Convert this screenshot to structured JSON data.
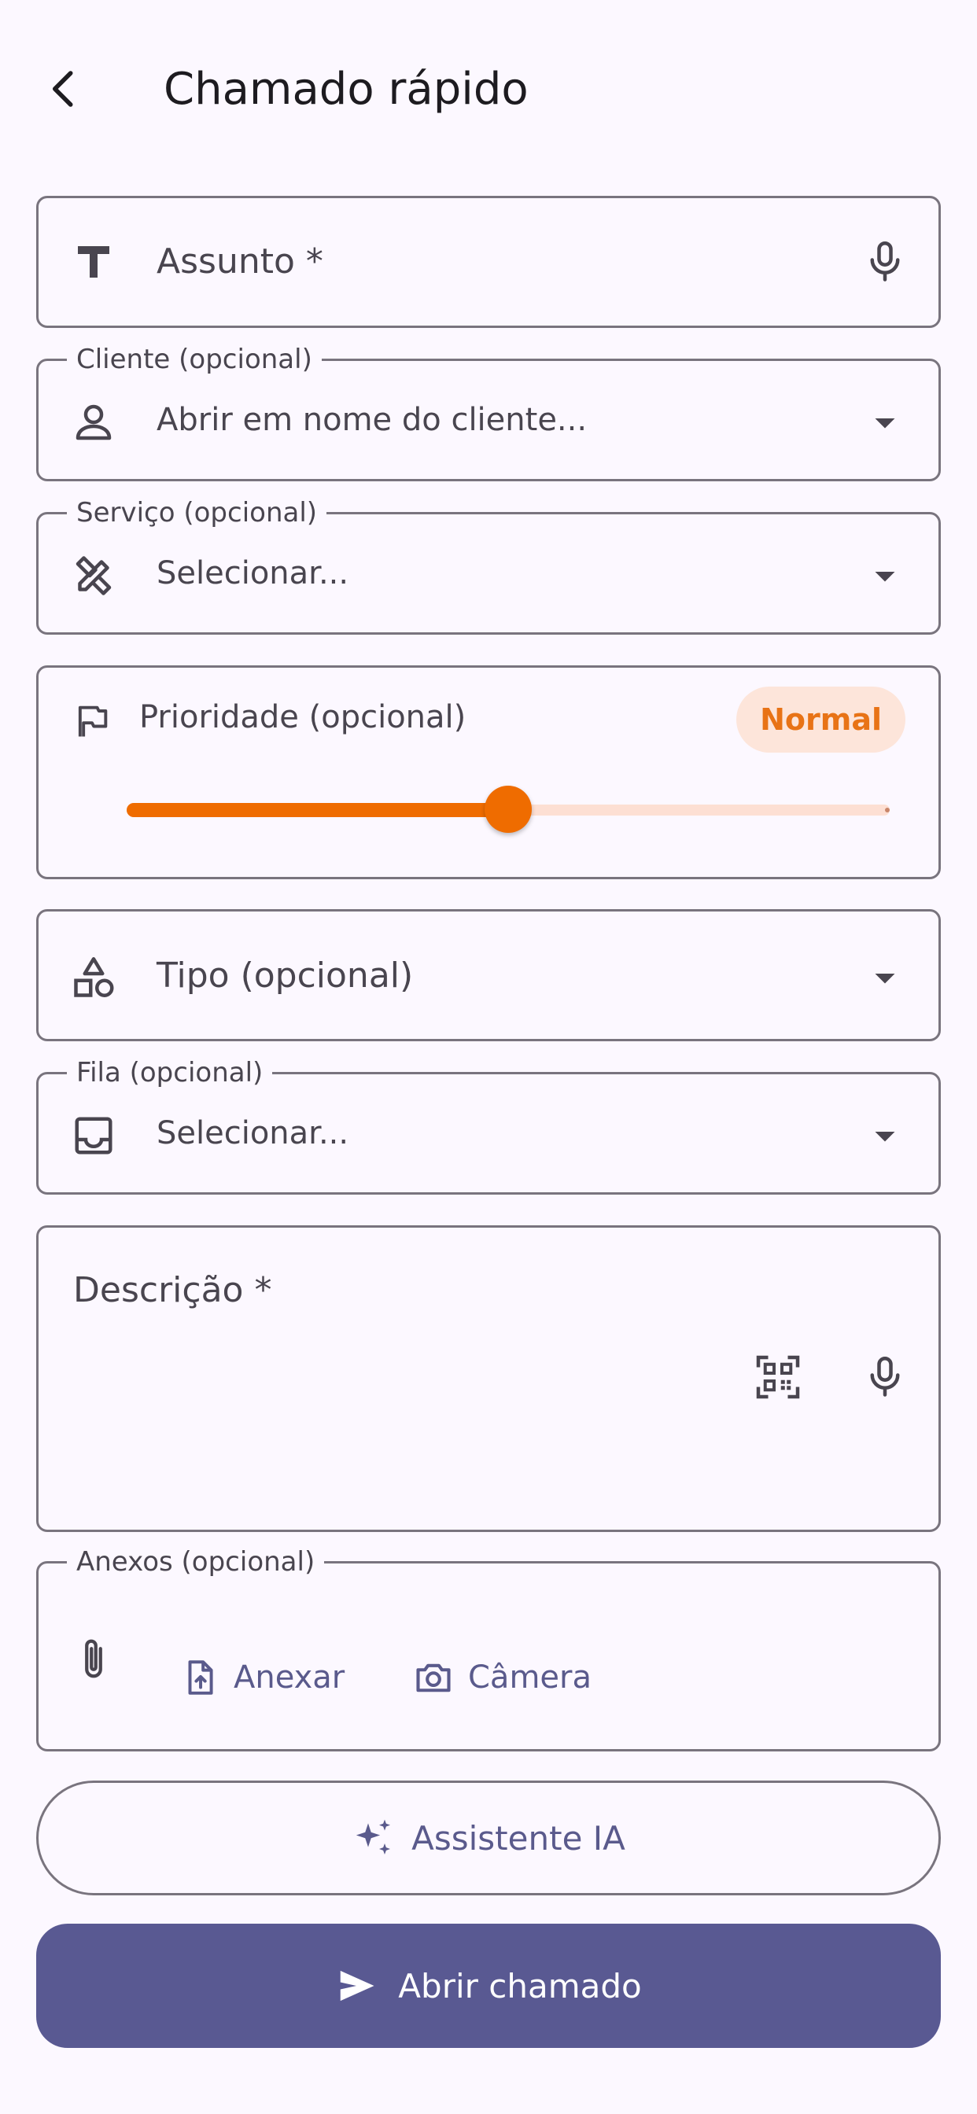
{
  "app_bar": {
    "title": "Chamado rápido",
    "back_icon": "arrow-back-icon"
  },
  "subject": {
    "placeholder": "Assunto *",
    "lead_icon": "text-format-icon",
    "trail_icon": "microphone-icon"
  },
  "client": {
    "label": "Cliente (opcional)",
    "value": "Abrir em nome do cliente...",
    "lead_icon": "person-icon"
  },
  "service": {
    "label": "Serviço (opcional)",
    "value": "Selecionar...",
    "lead_icon": "design-services-icon"
  },
  "priority": {
    "label": "Prioridade (opcional)",
    "badge": "Normal",
    "slider_fraction": 0.5,
    "lead_icon": "flag-icon",
    "accent_color": "#ef6c00"
  },
  "type": {
    "placeholder": "Tipo (opcional)",
    "lead_icon": "category-icon"
  },
  "queue": {
    "label": "Fila (opcional)",
    "value": "Selecionar...",
    "lead_icon": "inbox-icon"
  },
  "description": {
    "placeholder": "Descrição *",
    "qr_icon": "qr-code-scanner-icon",
    "mic_icon": "microphone-icon"
  },
  "attachments": {
    "label": "Anexos (opcional)",
    "attach_label": "Anexar",
    "camera_label": "Câmera",
    "lead_icon": "paperclip-icon"
  },
  "ai_button": {
    "label": "Assistente IA",
    "icon": "sparkle-icon"
  },
  "submit_button": {
    "label": "Abrir chamado",
    "icon": "send-icon",
    "color": "#595992"
  }
}
